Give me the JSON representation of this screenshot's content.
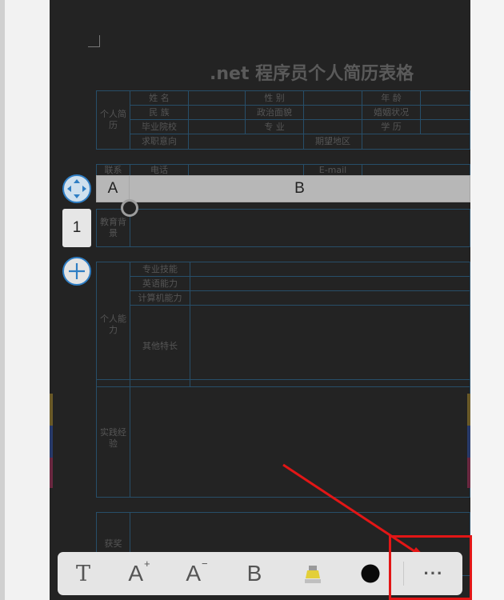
{
  "document": {
    "title": ".net 程序员个人简历表格",
    "sections": {
      "personal": {
        "label": "个人简历",
        "fields": [
          "姓 名",
          "民 族",
          "毕业院校",
          "求职意向",
          "性 别",
          "政治面貌",
          "专 业",
          "期望地区",
          "年 龄",
          "婚姻状况",
          "学 历"
        ]
      },
      "contact": {
        "label": "联系",
        "fields": [
          "电话",
          "E-mail"
        ]
      },
      "education": {
        "label": "教育背景"
      },
      "ability": {
        "label": "个人能力",
        "fields": [
          "专业技能",
          "英语能力",
          "计算机能力",
          "其他特长"
        ]
      },
      "practice": {
        "label": "实践经验"
      },
      "awards": {
        "label": "获奖"
      }
    }
  },
  "spreadsheet": {
    "columns": [
      "A",
      "B"
    ],
    "rows": [
      "1"
    ]
  },
  "toolbar": {
    "text_label": "T",
    "font_increase_label": "A",
    "font_increase_mark": "+",
    "font_decrease_label": "A",
    "font_decrease_mark": "−",
    "bold_label": "B",
    "more_label": "···"
  },
  "colors": {
    "accent": "#2f7ec4",
    "annotation": "#e21616",
    "highlighter": "#e3cf39",
    "cell_border": "#274e69"
  }
}
